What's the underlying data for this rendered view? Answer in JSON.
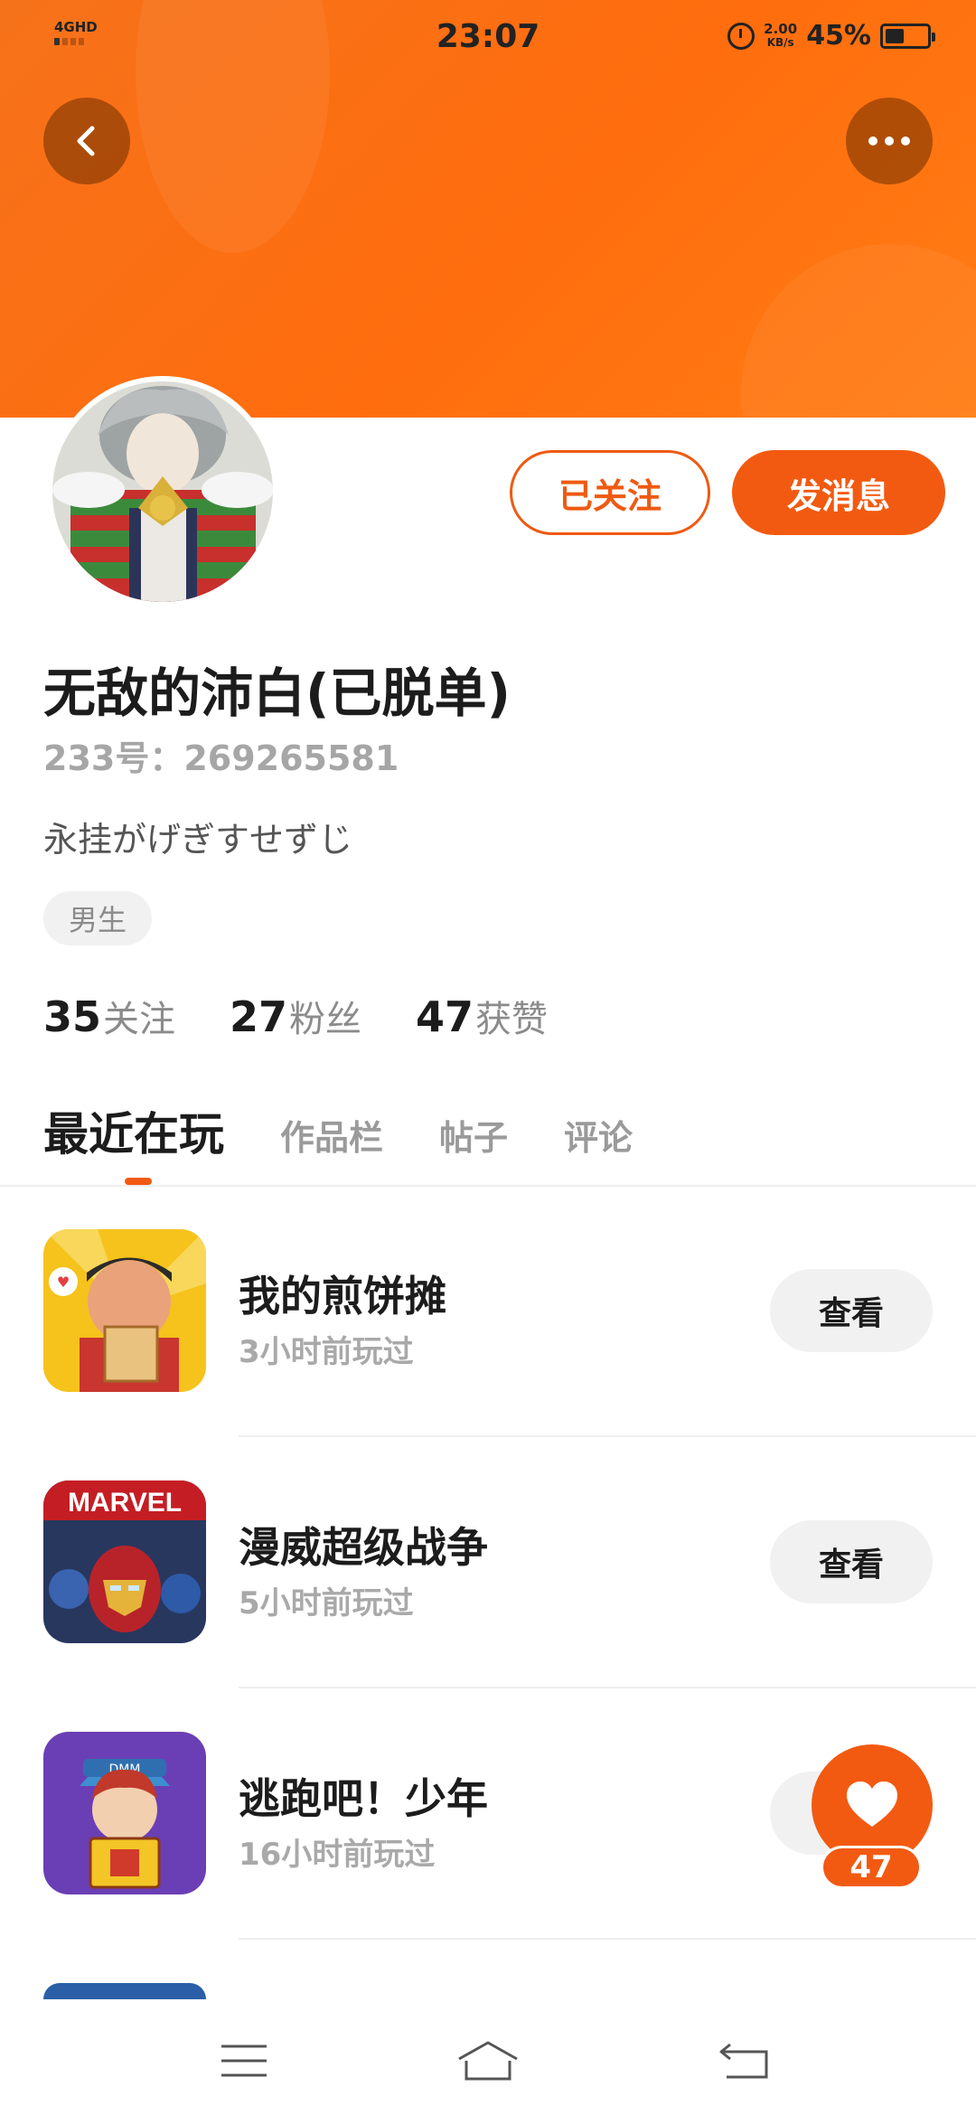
{
  "status_bar": {
    "network": "4GHD",
    "time": "23:07",
    "speed_value": "2.00",
    "speed_unit": "KB/s",
    "battery": "45%"
  },
  "icons": {
    "back": "back-arrow-icon",
    "more": "more-dots-icon",
    "like": "heart-icon",
    "menu": "menu-icon",
    "home": "home-icon",
    "return": "return-icon"
  },
  "actions": {
    "follow_label": "已关注",
    "message_label": "发消息"
  },
  "profile": {
    "username": "无敌的沛白(已脱单)",
    "user_id": "233号：269265581",
    "bio": "永挂がげぎすせずじ",
    "gender": "男生"
  },
  "stats": [
    {
      "value": "35",
      "label": "关注"
    },
    {
      "value": "27",
      "label": "粉丝"
    },
    {
      "value": "47",
      "label": "获赞"
    }
  ],
  "tabs": [
    "最近在玩",
    "作品栏",
    "帖子",
    "评论"
  ],
  "games": [
    {
      "title": "我的煎饼摊",
      "time": "3小时前玩过",
      "action": "查看"
    },
    {
      "title": "漫威超级战争",
      "time": "5小时前玩过",
      "action": "查看",
      "icon_text": "MARVEL"
    },
    {
      "title": "逃跑吧！少年",
      "time": "16小时前玩过",
      "action": "",
      "icon_text": "DMM"
    }
  ],
  "like_count": "47",
  "colors": {
    "accent": "#f25a11",
    "banner": "#ff6d0e"
  }
}
